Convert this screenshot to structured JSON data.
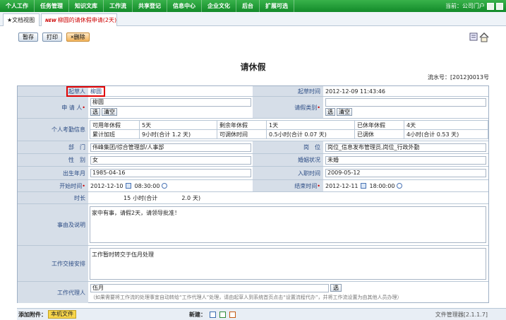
{
  "topnav": {
    "items": [
      "个人工作",
      "任务管理",
      "知识文库",
      "工作流",
      "共享登记",
      "信息中心",
      "企业文化",
      "后台",
      "扩展可选"
    ],
    "current": "当前：公司门户"
  },
  "tabs": {
    "view": "★文档视图",
    "doc": "柳圆的请休假申请(2天)",
    "new_badge": "NEW"
  },
  "toolbar": {
    "save": "暂存",
    "print": "打印",
    "delete": "×删除"
  },
  "doc": {
    "title": "请休假",
    "serial": "流水号：[2012]0013号"
  },
  "form": {
    "drafter_label": "起草人",
    "drafter": "柳圆",
    "draft_time_label": "起草时间",
    "draft_time": "2012-12-09 11:43:46",
    "applicant_label": "申 请 人",
    "applicant": "柳圆",
    "select": "选",
    "clear": "清空",
    "leave_type_label": "请假类别",
    "attendance_label": "个人考勤信息",
    "stats": [
      [
        "可用年休假",
        "5天",
        "剩余年休假",
        "1天",
        "已休年休假",
        "4天"
      ],
      [
        "累计加班",
        "9小时(合计 1.2 天)",
        "可调休时间",
        "0.5小时(合计 0.07 天)",
        "已调休",
        "4小时(合计 0.53 天)"
      ]
    ],
    "dept_label": "部　门",
    "dept": "伟峰集团/综合管理部/人事部",
    "post_label": "岗　位",
    "post": "岗位_信息发布管理员,岗位_行政外勤",
    "gender_label": "性　别",
    "gender": "女",
    "marital_label": "婚姻状况",
    "marital": "未婚",
    "birth_label": "出生年月",
    "birth": "1985-04-16",
    "join_label": "入职时间",
    "join": "2009-05-12",
    "start_label": "开始时间",
    "start_date": "2012-12-10",
    "start_time": "08:30:00",
    "end_label": "结束时间",
    "end_date": "2012-12-11",
    "end_time": "18:00:00",
    "duration_label": "时长",
    "duration_hours": "15",
    "duration_unit": "小时(合计",
    "duration_days": "2.0",
    "duration_days_unit": "天)",
    "reason_label": "事由及说明",
    "reason": "家中有事，请假2天，请领导批准！",
    "handover_label": "工作交接安排",
    "handover": "工作暂时转交于伍月处理",
    "agent_label": "工作代理人",
    "agent": "伍月",
    "agent_note": "（如果需要将工作流的处理事宜自动转给“工作代理人”处理，请由起草人到系统首页点击“设置流程代办”，并将工作流设置为由其他人员办理）"
  },
  "footer": {
    "attach_label": "添加附件：",
    "local_file": "本机文件",
    "new_label": "新建：",
    "file_manager": "文件管理器[2.1.1.7]"
  }
}
